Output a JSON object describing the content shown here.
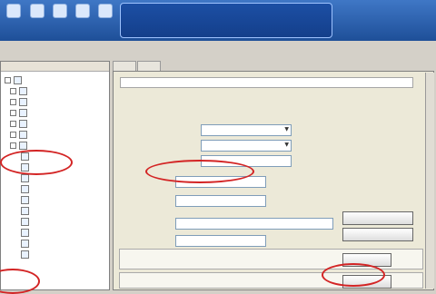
{
  "toolbar": {
    "items": [
      {
        "icon": "check-icon",
        "label": ""
      },
      {
        "icon": "play-icon",
        "label": ""
      },
      {
        "icon": "scan-icon",
        "label": ""
      },
      {
        "icon": "settings-icon",
        "label": ""
      },
      {
        "icon": "upgrade-icon",
        "label": ""
      }
    ],
    "stats": [
      {
        "label": "",
        "value": "",
        "label2": "",
        "value2": ""
      },
      {
        "label": "",
        "value": "",
        "label2": "",
        "value2": ""
      },
      {
        "label": "",
        "value": "",
        "label2": "",
        "value2": ""
      }
    ],
    "brand": ""
  },
  "sidebar": {
    "title": "",
    "items": [
      {
        "label": "",
        "icon": "folder-icon"
      },
      {
        "label": "",
        "icon": "shield-icon"
      },
      {
        "label": "",
        "icon": "system-icon"
      },
      {
        "label": "",
        "icon": "network-icon"
      },
      {
        "label": "",
        "icon": "log-icon"
      },
      {
        "label": "",
        "icon": "log-icon"
      },
      {
        "label": "",
        "icon": "tools-icon"
      },
      {
        "label": "",
        "icon": "register-icon"
      },
      {
        "label": "",
        "icon": "edit-icon"
      },
      {
        "label": "",
        "icon": "renew-icon"
      },
      {
        "label": "",
        "icon": "update-icon"
      },
      {
        "label": "",
        "icon": "upgrade-icon"
      },
      {
        "label": "",
        "icon": "password-icon"
      },
      {
        "label": "",
        "icon": "import-icon"
      },
      {
        "label": "",
        "icon": "file-icon"
      },
      {
        "label": "",
        "icon": "help-icon"
      },
      {
        "label": "",
        "icon": "about-icon"
      }
    ]
  },
  "main": {
    "tabs": [
      "",
      ""
    ],
    "notice": "",
    "description": "",
    "fields": {
      "country": {
        "label": "",
        "value": ""
      },
      "province": {
        "label": "",
        "value": ""
      },
      "city": {
        "label": "",
        "value": ""
      },
      "email": {
        "label": "",
        "value": ""
      },
      "phone": {
        "label": "",
        "value": ""
      },
      "serial": {
        "label": "",
        "value": ""
      },
      "user_password": {
        "label": "",
        "value": ""
      }
    },
    "email_hint": "",
    "buttons": {
      "get_serial": "",
      "register_personal": "",
      "change_password": "",
      "reset_password": ""
    },
    "change_password_text": "",
    "reset_password_text": ""
  },
  "colors": {
    "accent": "#2d63b5",
    "highlight": "#d32424"
  }
}
